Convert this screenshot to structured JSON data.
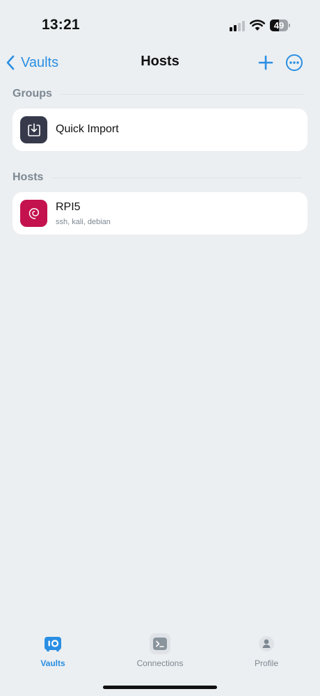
{
  "status_bar": {
    "time": "13:21",
    "battery_level": "49"
  },
  "nav": {
    "back_label": "Vaults",
    "title": "Hosts",
    "accent_color": "#2a8ee3"
  },
  "groups_section": {
    "header": "Groups",
    "items": [
      {
        "label": "Quick Import",
        "icon": "import-icon",
        "icon_bg": "#363a4a"
      }
    ]
  },
  "hosts_section": {
    "header": "Hosts",
    "items": [
      {
        "label": "RPI5",
        "tags": "ssh, kali, debian",
        "icon": "debian-logo-icon",
        "icon_bg": "#c4124f"
      }
    ]
  },
  "tabbar": {
    "tabs": [
      {
        "label": "Vaults",
        "icon": "vault-icon",
        "active": true
      },
      {
        "label": "Connections",
        "icon": "terminal-icon",
        "active": false
      },
      {
        "label": "Profile",
        "icon": "person-icon",
        "active": false
      }
    ]
  }
}
